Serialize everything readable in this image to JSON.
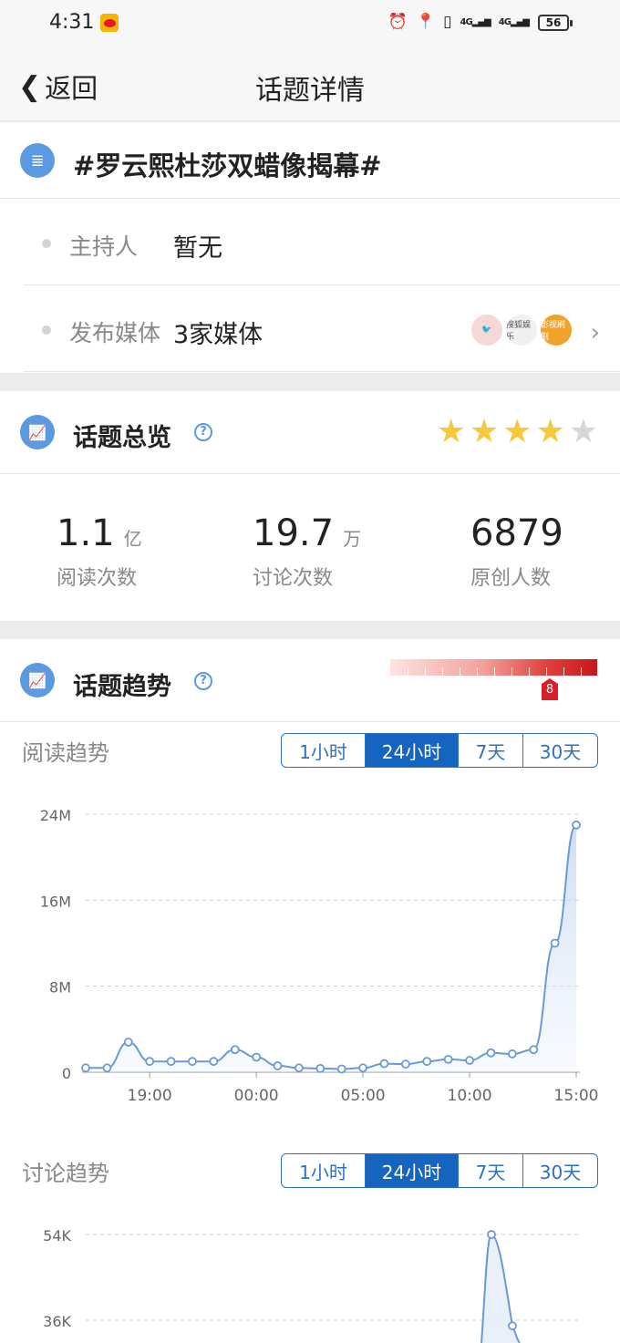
{
  "status": {
    "time": "4:31",
    "battery": "56"
  },
  "nav": {
    "back_label": "返回",
    "title": "话题详情"
  },
  "topic": {
    "title": "#罗云熙杜莎双蜡像揭幕#",
    "host_label": "主持人",
    "host_value": "暂无",
    "media_label": "发布媒体",
    "media_value": "3家媒体",
    "media_logos": [
      "logo-1",
      "搜狐娱乐",
      "影视刷剧"
    ]
  },
  "overview": {
    "title": "话题总览",
    "rating": 4,
    "rating_max": 5,
    "stats": [
      {
        "num": "1.1",
        "unit": "亿",
        "label": "阅读次数"
      },
      {
        "num": "19.7",
        "unit": "万",
        "label": "讨论次数"
      },
      {
        "num": "6879",
        "unit": "",
        "label": "原创人数"
      }
    ]
  },
  "trend": {
    "title": "话题趋势",
    "heat_level": "8",
    "tabs": [
      "1小时",
      "24小时",
      "7天",
      "30天"
    ],
    "active_tab": 1
  },
  "read_chart_title": "阅读趋势",
  "discuss_chart_title": "讨论趋势",
  "chart_data": [
    {
      "type": "area",
      "title": "阅读趋势",
      "y_ticks": [
        "0",
        "8M",
        "16M",
        "24M"
      ],
      "ylim": [
        0,
        24000000
      ],
      "x_tick_labels": [
        "19:00",
        "00:00",
        "05:00",
        "10:00",
        "15:00"
      ],
      "x_tick_index": [
        3,
        8,
        13,
        18,
        23
      ],
      "values": [
        400000,
        400000,
        2800000,
        1000000,
        1000000,
        1000000,
        1000000,
        2100000,
        1400000,
        600000,
        400000,
        350000,
        300000,
        400000,
        800000,
        750000,
        1000000,
        1200000,
        1100000,
        1800000,
        1700000,
        2100000,
        12000000,
        23000000
      ],
      "grid": true
    },
    {
      "type": "area",
      "title": "讨论趋势",
      "y_ticks": [
        "36K",
        "54K"
      ],
      "values_visible": [
        {
          "index": 19,
          "value": 54000
        },
        {
          "index": 20,
          "value": 35000
        }
      ],
      "grid": true
    }
  ]
}
